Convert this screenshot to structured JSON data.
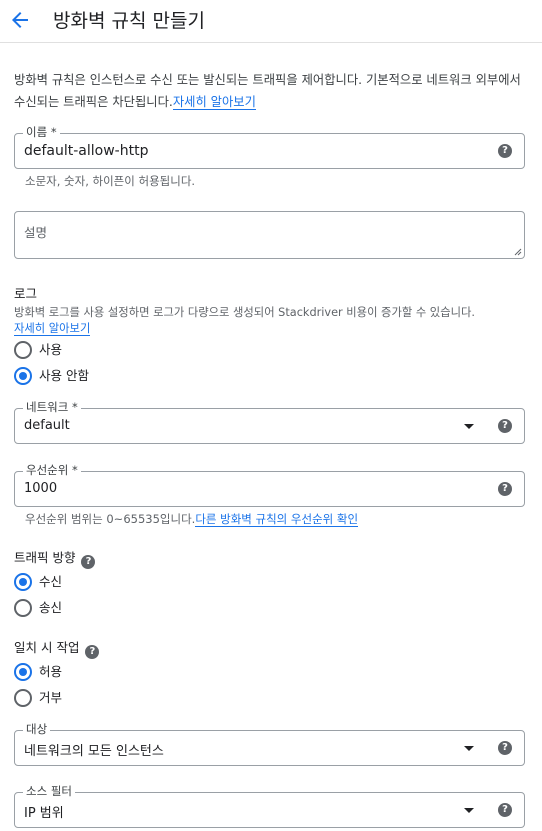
{
  "header": {
    "title": "방화벽 규칙 만들기"
  },
  "intro": {
    "text": "방화벽 규칙은 인스턴스로 수신 또는 발신되는 트래픽을 제어합니다. 기본적으로 네트워크 외부에서 수신되는 트래픽은 차단됩니다.",
    "link": "자세히 알아보기"
  },
  "name": {
    "label": "이름 *",
    "value": "default-allow-http",
    "hint": "소문자, 숫자, 하이픈이 허용됩니다."
  },
  "description": {
    "placeholder": "설명"
  },
  "logs": {
    "title": "로그",
    "text": "방화벽 로그를 사용 설정하면 로그가 다량으로 생성되어 Stackdriver 비용이 증가할 수 있습니다.",
    "link": "자세히 알아보기",
    "options": [
      "사용",
      "사용 안함"
    ],
    "selected": "사용 안함"
  },
  "network": {
    "label": "네트워크 *",
    "value": "default"
  },
  "priority": {
    "label": "우선순위 *",
    "value": "1000",
    "hint": "우선순위 범위는 0~65535입니다.",
    "hint_link": "다른 방화벽 규칙의 우선순위 확인"
  },
  "direction": {
    "title": "트래픽 방향",
    "options": [
      "수신",
      "송신"
    ],
    "selected": "수신"
  },
  "action": {
    "title": "일치 시 작업",
    "options": [
      "허용",
      "거부"
    ],
    "selected": "허용"
  },
  "targets": {
    "label": "대상",
    "value": "네트워크의 모든 인스턴스"
  },
  "source_filter": {
    "label": "소스 필터",
    "value": "IP 범위"
  },
  "icons": {
    "back": "arrow-back-icon",
    "help": "help-icon",
    "dropdown": "dropdown-caret-icon"
  },
  "colors": {
    "accent": "#1a73e8",
    "border": "#9aa0a6",
    "help": "#5f6368"
  }
}
